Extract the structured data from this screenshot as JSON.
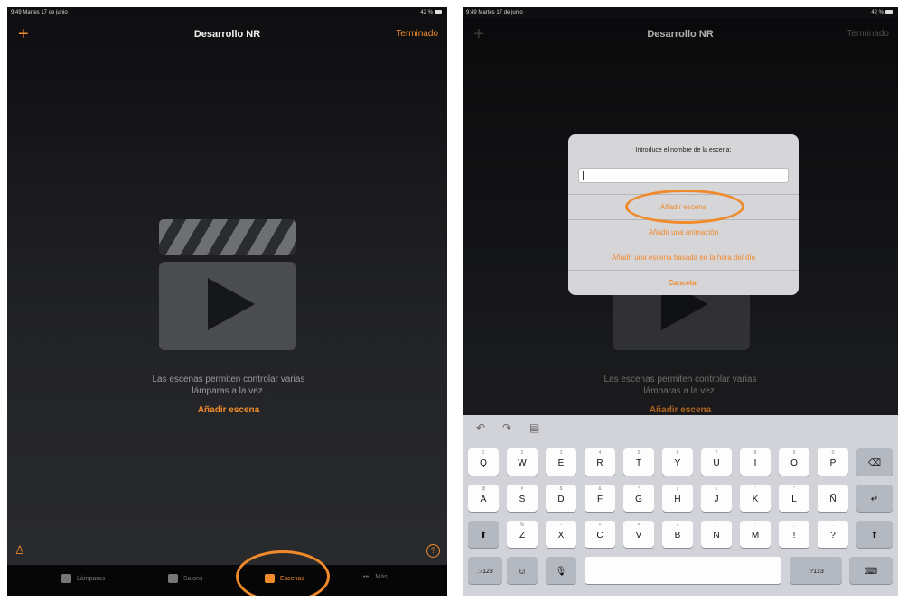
{
  "status_bar": {
    "time_date": "9:49  Martes 17 de junio",
    "battery": "42 %"
  },
  "left_screen": {
    "nav": {
      "add_icon": "plus-icon",
      "title": "Desarrollo NR",
      "done": "Terminado"
    },
    "empty_state": {
      "icon": "clapperboard-icon",
      "line1": "Las escenas permiten controlar varias",
      "line2": "lámparas a la vez.",
      "link": "Añadir escena"
    },
    "tabs": [
      {
        "label": "Lámparas",
        "icon": "lamp-icon"
      },
      {
        "label": "Salons",
        "icon": "rooms-icon"
      },
      {
        "label": "Escenas",
        "icon": "scenes-icon",
        "active": true
      },
      {
        "label": "Más",
        "icon": "more-icon"
      }
    ]
  },
  "right_screen": {
    "nav": {
      "title": "Desarrollo NR",
      "done": "Terminado"
    },
    "dialog": {
      "message": "Introduce el nombre de la escena:",
      "input_value": "",
      "actions": [
        "Añadir escena",
        "Añadir una animación",
        "Añadir una escena basada en la hora del día",
        "Cancelar"
      ]
    },
    "background_text": {
      "line1": "Las escenas permiten controlar varias",
      "line2": "lámparas a la vez.",
      "link": "Añadir escena"
    },
    "keyboard": {
      "row1": [
        "Q",
        "W",
        "E",
        "R",
        "T",
        "Y",
        "U",
        "I",
        "O",
        "P"
      ],
      "row1_sub": [
        "1",
        "2",
        "3",
        "4",
        "5",
        "6",
        "7",
        "8",
        "9",
        "0"
      ],
      "row2": [
        "A",
        "S",
        "D",
        "F",
        "G",
        "H",
        "J",
        "K",
        "L",
        "Ñ"
      ],
      "row2_sub": [
        "@",
        "#",
        "$",
        "&",
        "*",
        "(",
        ")",
        "'",
        "\"",
        ""
      ],
      "row3": [
        "Z",
        "X",
        "C",
        "V",
        "B",
        "N",
        "M",
        "!",
        "?"
      ],
      "row3_sub": [
        "%",
        "-",
        "+",
        "=",
        "/",
        ";",
        ":",
        ",",
        "."
      ],
      "numbers_key_left": ".?123",
      "numbers_key_right": ".?123"
    }
  },
  "colors": {
    "accent": "#f28b2b",
    "highlight_ring": "#f08a2a"
  }
}
